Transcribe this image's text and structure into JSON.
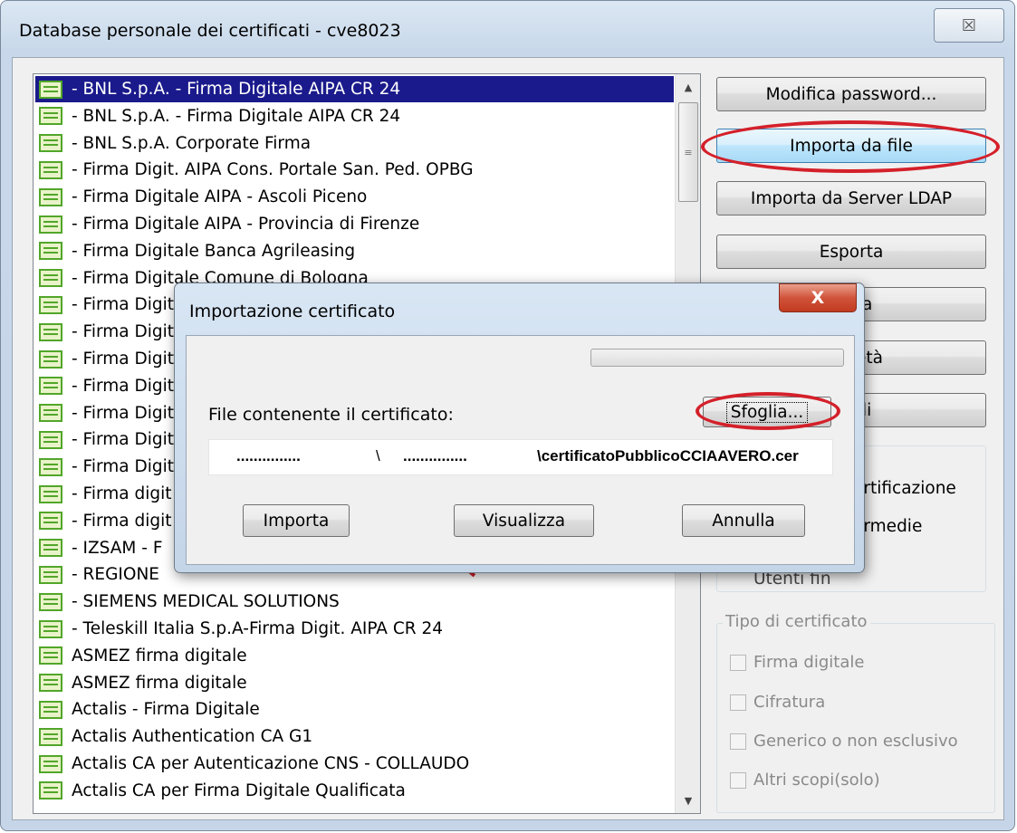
{
  "window": {
    "title": "Database personale dei certificati - cve8023",
    "close_glyph": "☒"
  },
  "cert_list": [
    "- BNL S.p.A. - Firma Digitale AIPA CR 24",
    "- BNL S.p.A. - Firma Digitale AIPA CR 24",
    "- BNL S.p.A. Corporate Firma",
    "- Firma Digit. AIPA Cons. Portale San. Ped. OPBG",
    "- Firma Digitale AIPA - Ascoli Piceno",
    "- Firma Digitale AIPA - Provincia di Firenze",
    "- Firma Digitale Banca Agrileasing",
    "- Firma Digitale Comune di Bologna",
    "- Firma Digit",
    "- Firma Digit",
    "- Firma Digit",
    "- Firma Digit",
    "- Firma Digit",
    "- Firma Digit",
    "- Firma Digit",
    "- Firma digit",
    "- Firma digit",
    "- IZSAM - F",
    "- REGIONE",
    "- SIEMENS MEDICAL SOLUTIONS",
    "- Teleskill Italia S.p.A-Firma Digit. AIPA CR 24",
    "ASMEZ firma digitale",
    "ASMEZ firma digitale",
    "Actalis - Firma Digitale",
    "Actalis Authentication CA G1",
    "Actalis CA per Autenticazione CNS - COLLAUDO",
    "Actalis CA per Firma Digitale Qualificata"
  ],
  "scroll": {
    "up": "▲",
    "down": "▼",
    "grip": "≡"
  },
  "buttons": {
    "modifica_password": "Modifica password...",
    "importa_da_file": "Importa da file",
    "importa_ldap": "Importa da Server LDAP",
    "esporta": "Esporta",
    "btn5_partial": "a",
    "btn6_partial": "età",
    "btn7_partial": "li"
  },
  "radio_group": {
    "line1_partial": "ertificazione",
    "line2_partial": "ermedie",
    "line3_partial": "Utenti fin"
  },
  "tipo_certificato": {
    "legend": "Tipo di certificato",
    "options": [
      "Firma digitale",
      "Cifratura",
      "Generico o non esclusivo",
      "Altri scopi(solo)"
    ]
  },
  "dialog": {
    "title": "Importazione certificato",
    "close_glyph": "X",
    "file_label": "File contenente il certificato:",
    "browse_label": "Sfoglia...",
    "path_dots_1": "...............",
    "path_sep": "\\",
    "path_dots_2": "...............",
    "path_file": "\\certificatoPubblicoCCIAAVERO.cer",
    "importa_label": "Importa",
    "visualizza_label": "Visualizza",
    "annulla_label": "Annulla"
  },
  "colors": {
    "highlight": "#d4202a",
    "selection": "#1a1a8c"
  }
}
